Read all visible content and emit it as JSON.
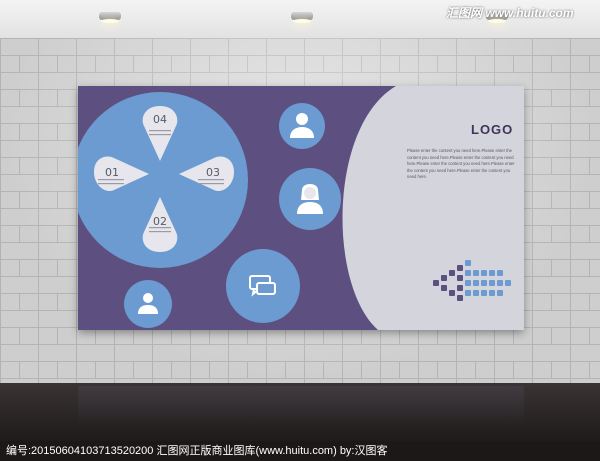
{
  "board": {
    "logo": "LOGO",
    "paragraph": "Please enter the content you need here.Please enter the content you need here.Please enter the content you need here.Please enter the content you need here.Please enter the content you need here.Please enter the content you need here.",
    "numbers": [
      "04",
      "01",
      "03",
      "02"
    ]
  },
  "colors": {
    "purple": "#5d5080",
    "blue": "#6b9bd1",
    "light": "#d4d4dc"
  },
  "icons": [
    "user-icon",
    "female-user-icon",
    "chat-icon",
    "user-icon"
  ],
  "watermark": "汇图网 www.huitu.com",
  "caption": "编号:20150604103713520200   汇图网正版商业图库(www.huitu.com) by:汉图客"
}
